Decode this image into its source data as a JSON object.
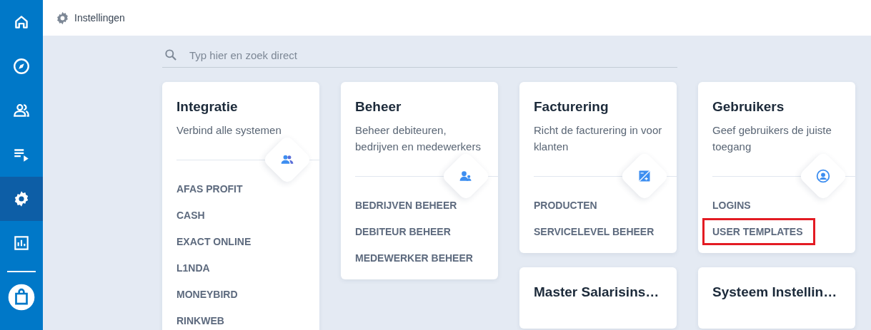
{
  "sidebar": {
    "items": [
      {
        "selected": false
      },
      {
        "selected": false
      },
      {
        "selected": false
      },
      {
        "selected": false
      },
      {
        "selected": true
      },
      {
        "selected": false
      },
      {
        "selected": false
      }
    ]
  },
  "header": {
    "title": "Instellingen"
  },
  "search": {
    "placeholder": "Typ hier en zoek direct"
  },
  "columns": [
    {
      "cards": [
        {
          "title": "Integratie",
          "description": "Verbind alle systemen",
          "items": [
            {
              "label": "AFAS PROFIT",
              "highlighted": false
            },
            {
              "label": "CASH",
              "highlighted": false
            },
            {
              "label": "EXACT ONLINE",
              "highlighted": false
            },
            {
              "label": "L1NDA",
              "highlighted": false
            },
            {
              "label": "MONEYBIRD",
              "highlighted": false
            },
            {
              "label": "RINKWEB",
              "highlighted": false
            }
          ]
        }
      ]
    },
    {
      "cards": [
        {
          "title": "Beheer",
          "description": "Beheer debiteuren, bedrijven en medewerkers",
          "items": [
            {
              "label": "BEDRIJVEN BEHEER",
              "highlighted": false
            },
            {
              "label": "DEBITEUR BEHEER",
              "highlighted": false
            },
            {
              "label": "MEDEWERKER BEHEER",
              "highlighted": false
            }
          ]
        }
      ]
    },
    {
      "cards": [
        {
          "title": "Facturering",
          "description": "Richt de facturering in voor klanten",
          "items": [
            {
              "label": "PRODUCTEN",
              "highlighted": false
            },
            {
              "label": "SERVICELEVEL BEHEER",
              "highlighted": false
            }
          ]
        },
        {
          "title": "Master Salarisins…"
        }
      ]
    },
    {
      "cards": [
        {
          "title": "Gebruikers",
          "description": "Geef gebruikers de juiste toegang",
          "items": [
            {
              "label": "LOGINS",
              "highlighted": false
            },
            {
              "label": "USER TEMPLATES",
              "highlighted": true
            }
          ]
        },
        {
          "title": "Systeem Instellin…"
        }
      ]
    }
  ]
}
